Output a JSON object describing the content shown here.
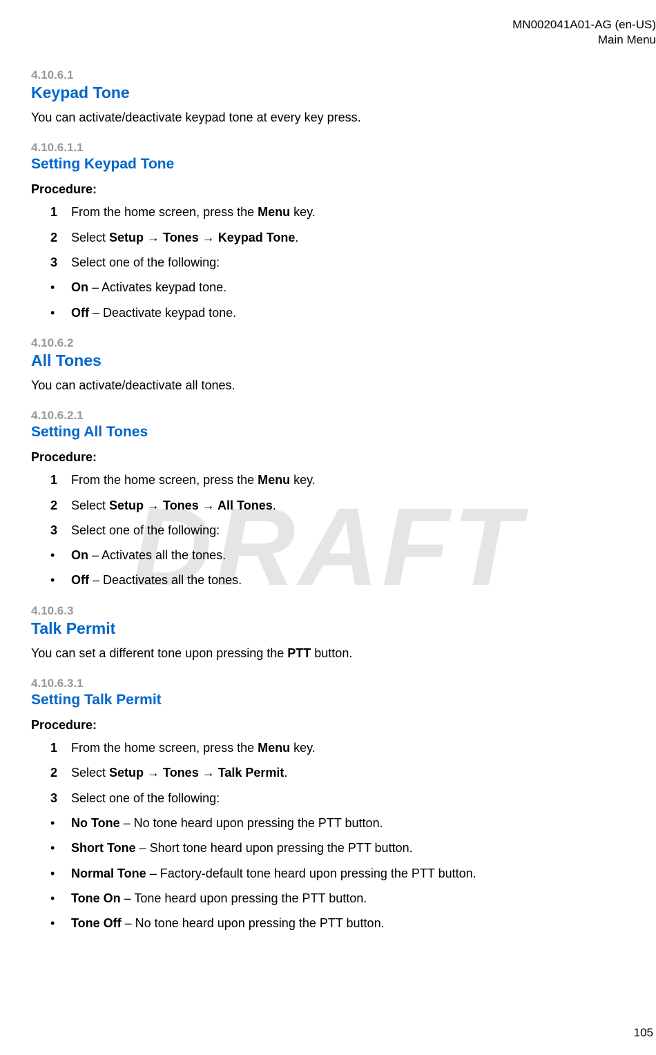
{
  "header": {
    "doc_id": "MN002041A01-AG (en-US)",
    "breadcrumb": "Main Menu"
  },
  "watermark": "DRAFT",
  "page_number": "105",
  "sections": [
    {
      "number": "4.10.6.1",
      "title": "Keypad Tone",
      "level": "h2",
      "body_html": "You can activate/deactivate keypad tone at every key press."
    },
    {
      "number": "4.10.6.1.1",
      "title": "Setting Keypad Tone",
      "level": "h3",
      "procedure": {
        "label": "Procedure:",
        "steps": [
          {
            "html": "From the home screen, press the <b>Menu</b> key."
          },
          {
            "html": "Select <b>Setup → Tones → Keypad Tone</b>."
          },
          {
            "html": "Select one of the following:",
            "bullets": [
              {
                "html": "<b>On</b> – Activates keypad tone."
              },
              {
                "html": "<b>Off</b> – Deactivate keypad tone."
              }
            ]
          }
        ]
      }
    },
    {
      "number": "4.10.6.2",
      "title": "All Tones",
      "level": "h2",
      "body_html": "You can activate/deactivate all tones."
    },
    {
      "number": "4.10.6.2.1",
      "title": "Setting All Tones",
      "level": "h3",
      "procedure": {
        "label": "Procedure:",
        "steps": [
          {
            "html": "From the home screen, press the <b>Menu</b> key."
          },
          {
            "html": "Select <b>Setup → Tones → All Tones</b>."
          },
          {
            "html": "Select one of the following:",
            "bullets": [
              {
                "html": "<b>On</b> – Activates all the tones."
              },
              {
                "html": "<b>Off</b> – Deactivates all the tones."
              }
            ]
          }
        ]
      }
    },
    {
      "number": "4.10.6.3",
      "title": "Talk Permit",
      "level": "h2",
      "body_html": "You can set a different tone upon pressing the <b>PTT</b> button."
    },
    {
      "number": "4.10.6.3.1",
      "title": "Setting Talk Permit",
      "level": "h3",
      "procedure": {
        "label": "Procedure:",
        "steps": [
          {
            "html": "From the home screen, press the <b>Menu</b> key."
          },
          {
            "html": "Select <b>Setup → Tones → Talk Permit</b>."
          },
          {
            "html": "Select one of the following:",
            "bullets": [
              {
                "html": "<b>No Tone</b> – No tone heard upon pressing the PTT button."
              },
              {
                "html": "<b>Short Tone</b> – Short tone heard upon pressing the PTT button."
              },
              {
                "html": "<b>Normal Tone</b> – Factory-default tone heard upon pressing the PTT button."
              },
              {
                "html": "<b>Tone On</b> – Tone heard upon pressing the PTT button."
              },
              {
                "html": "<b>Tone Off</b> – No tone heard upon pressing the PTT button."
              }
            ]
          }
        ]
      }
    }
  ]
}
